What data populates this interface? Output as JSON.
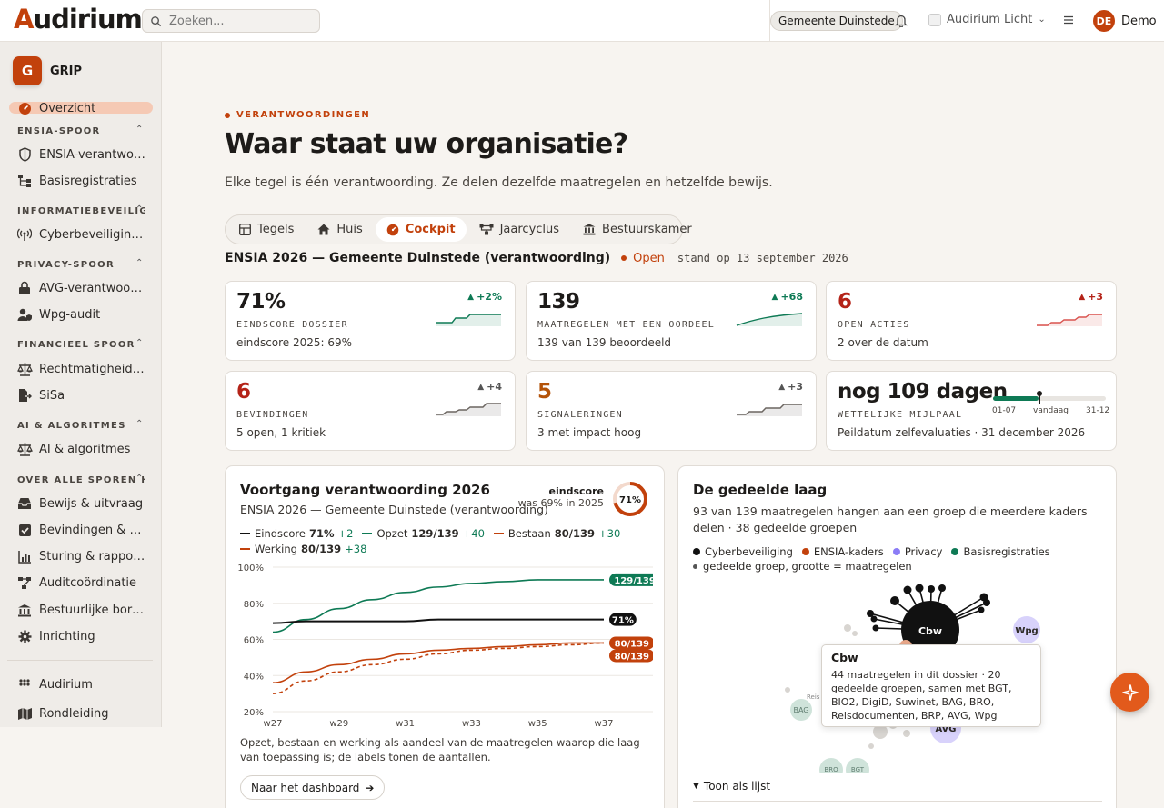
{
  "header": {
    "logo": "Audirium",
    "search_placeholder": "Zoeken...",
    "org": "Gemeente Duinstede",
    "theme": "Audirium Licht",
    "user_initials": "DE",
    "user_name": "Demo"
  },
  "sidebar": {
    "app_initial": "G",
    "app_name": "GRIP",
    "overview": "Overzicht",
    "sections": [
      {
        "title": "ENSIA-SPOOR",
        "items": [
          "ENSIA-verantwoordingen",
          "Basisregistraties"
        ]
      },
      {
        "title": "INFORMATIEBEVEILIGING",
        "items": [
          "Cyberbeveiligingswet"
        ]
      },
      {
        "title": "PRIVACY-SPOOR",
        "items": [
          "AVG-verantwoording",
          "Wpg-audit"
        ]
      },
      {
        "title": "FINANCIEEL SPOOR",
        "items": [
          "Rechtmatigheid (VIR)",
          "SiSa"
        ]
      },
      {
        "title": "AI & ALGORITMES",
        "items": [
          "AI & algoritmes"
        ]
      },
      {
        "title": "OVER ALLE SPOREN HEEN",
        "items": [
          "Bewijs & uitvraag",
          "Bevindingen & acties",
          "Sturing & rapportage",
          "Auditcoördinatie",
          "Bestuurlijke borging",
          "Inrichting"
        ]
      }
    ],
    "footer": [
      "Audirium",
      "Rondleiding"
    ]
  },
  "main": {
    "kicker": "VERANTWOORDINGEN",
    "title": "Waar staat uw organisatie?",
    "lead": "Elke tegel is één verantwoording. Ze delen dezelfde maatregelen en hetzelfde bewijs.",
    "tabs": [
      "Tegels",
      "Huis",
      "Cockpit",
      "Jaarcyclus",
      "Bestuurskamer"
    ],
    "active_tab": "Cockpit",
    "dossier_title": "ENSIA 2026 — Gemeente Duinstede (verantwoording)",
    "status": "Open",
    "as_of": "stand op 13 september 2026"
  },
  "tiles": [
    {
      "value": "71%",
      "label": "EINDSCORE DOSSIER",
      "sub": "eindscore 2025: 69%",
      "delta": "+2%",
      "value_color": "#1d1b19",
      "delta_color": "#0e7a55",
      "spark_color": "#0e7a55"
    },
    {
      "value": "139",
      "label": "MAATREGELEN MET EEN OORDEEL",
      "sub": "139 van 139 beoordeeld",
      "delta": "+68",
      "value_color": "#1d1b19",
      "delta_color": "#0e7a55",
      "spark_color": "#0e7a55"
    },
    {
      "value": "6",
      "label": "OPEN ACTIES",
      "sub": "2 over de datum",
      "delta": "+3",
      "value_color": "#b42318",
      "delta_color": "#b42318",
      "spark_color": "#d9534f"
    },
    {
      "value": "6",
      "label": "BEVINDINGEN",
      "sub": "5 open, 1 kritiek",
      "delta": "+4",
      "value_color": "#b42318",
      "delta_color": "#555555",
      "spark_color": "#6b6560"
    },
    {
      "value": "5",
      "label": "SIGNALERINGEN",
      "sub": "3 met impact hoog",
      "delta": "+3",
      "value_color": "#b45309",
      "delta_color": "#555555",
      "spark_color": "#6b6560"
    }
  ],
  "deadline": {
    "value": "nog 109 dagen",
    "label": "WETTELIJKE MIJLPAAL",
    "sub": "Peildatum zelfevaluaties · 31 december 2026",
    "progress": 0.4,
    "start": "01-07",
    "today": "vandaag",
    "end": "31-12"
  },
  "progress_card": {
    "title": "Voortgang verantwoording 2026",
    "subtitle": "ENSIA 2026 — Gemeente Duinstede (verantwoording)",
    "score_label": "eindscore",
    "score_prev": "was 69% in 2025",
    "score_value": "71%",
    "score_fraction": 0.71,
    "legend": [
      {
        "name": "Eindscore",
        "value": "71%",
        "delta": "+2",
        "color": "#111111"
      },
      {
        "name": "Opzet",
        "value": "129/139",
        "delta": "+40",
        "color": "#0e7a55"
      },
      {
        "name": "Bestaan",
        "value": "80/139",
        "delta": "+30",
        "color": "#c2410c"
      },
      {
        "name": "Werking",
        "value": "80/139",
        "delta": "+38",
        "color": "#c2410c"
      }
    ],
    "footnote": "Opzet, bestaan en werking als aandeel van de maatregelen waarop die laag van toepassing is; de labels tonen de aantallen.",
    "button": "Naar het dashboard"
  },
  "chart_data": {
    "type": "line",
    "x": [
      "w27",
      "w28",
      "w29",
      "w30",
      "w31",
      "w32",
      "w33",
      "w34",
      "w35",
      "w36",
      "w37"
    ],
    "xticks": [
      "w27",
      "w29",
      "w31",
      "w33",
      "w35",
      "w37"
    ],
    "ylim": [
      20,
      100
    ],
    "yticks": [
      "20%",
      "40%",
      "60%",
      "80%",
      "100%"
    ],
    "series": [
      {
        "name": "Opzet",
        "color": "#0e7a55",
        "dash": false,
        "values": [
          64,
          71,
          77,
          82,
          86,
          89,
          91,
          92,
          93,
          93,
          93
        ],
        "end_label": "129/139"
      },
      {
        "name": "Eindscore",
        "color": "#111111",
        "dash": false,
        "values": [
          69,
          70,
          70,
          70,
          70,
          71,
          71,
          71,
          71,
          71,
          71
        ],
        "end_label": "71%"
      },
      {
        "name": "Bestaan",
        "color": "#c2410c",
        "dash": false,
        "values": [
          36,
          42,
          46,
          49,
          52,
          54,
          55,
          56,
          57,
          58,
          58
        ],
        "end_label": "80/139"
      },
      {
        "name": "Werking",
        "color": "#c2410c",
        "dash": true,
        "values": [
          30,
          37,
          42,
          46,
          49,
          52,
          54,
          55,
          56,
          57,
          58
        ],
        "end_label": "80/139"
      }
    ]
  },
  "shared_card": {
    "title": "De gedeelde laag",
    "subtitle": "93 van 139 maatregelen hangen aan een groep die meerdere kaders delen · 38 gedeelde groepen",
    "legend": [
      {
        "name": "Cyberbeveiliging",
        "color": "#111111"
      },
      {
        "name": "ENSIA-kaders",
        "color": "#c2410c"
      },
      {
        "name": "Privacy",
        "color": "#8b7cf6"
      },
      {
        "name": "Basisregistraties",
        "color": "#0e7a55"
      }
    ],
    "legend_note": "gedeelde groep, grootte = maatregelen",
    "nodes": [
      "Cbw",
      "Wpg",
      "AVG",
      "BAG",
      "BRO",
      "BGT",
      "Reis"
    ],
    "tooltip_title": "Cbw",
    "tooltip_body": "44 maatregelen in dit dossier · 20 gedeelde groepen, samen met BGT, BIO2, DigiD, Suwinet, BAG, BRO, Reisdocumenten, BRP, AVG, Wpg",
    "toggle": "Toon als lijst"
  }
}
